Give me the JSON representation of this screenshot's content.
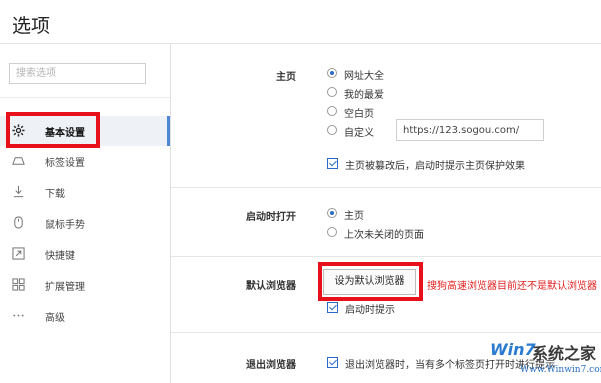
{
  "window": {
    "title": "选项"
  },
  "sidebar": {
    "search_placeholder": "搜索选项",
    "items": [
      {
        "label": "基本设置",
        "icon": "gear-icon",
        "active": true
      },
      {
        "label": "标签设置",
        "icon": "tab-icon"
      },
      {
        "label": "下载",
        "icon": "download-icon"
      },
      {
        "label": "鼠标手势",
        "icon": "mouse-icon"
      },
      {
        "label": "快捷键",
        "icon": "shortcut-icon"
      },
      {
        "label": "扩展管理",
        "icon": "extensions-icon"
      },
      {
        "label": "高级",
        "icon": "more-icon"
      }
    ]
  },
  "homepage": {
    "label": "主页",
    "options": [
      "网址大全",
      "我的最爱",
      "空白页",
      "自定义"
    ],
    "selected": "网址大全",
    "custom_url": "https://123.sogou.com/",
    "protect_checkbox": "主页被篡改后，启动时提示主页保护效果"
  },
  "startup": {
    "label": "启动时打开",
    "options": [
      "主页",
      "上次未关闭的页面"
    ],
    "selected": "主页"
  },
  "default_browser": {
    "label": "默认浏览器",
    "button": "设为默认浏览器",
    "warning": "搜狗高速浏览器目前还不是默认浏览器",
    "startup_check": "启动时提示"
  },
  "exit_browser": {
    "label": "退出浏览器",
    "checkbox": "退出浏览器时，当有多个标签页打开时进行提示"
  },
  "watermark": {
    "brand": "Win7",
    "brand_suffix": "系统之家",
    "site": "Www.Winwin7.com"
  },
  "colors": {
    "accent": "#2d6bc8",
    "highlight": "#e8101a",
    "warning": "#e02020"
  }
}
